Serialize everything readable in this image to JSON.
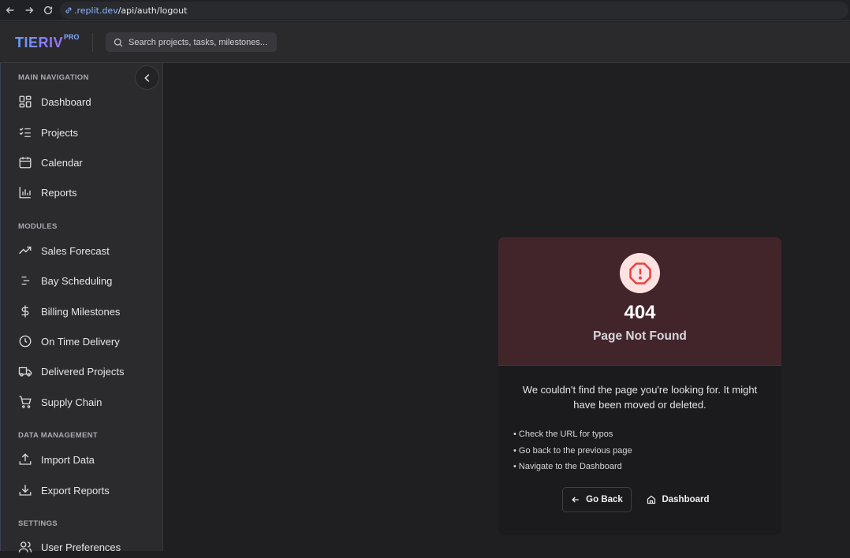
{
  "browser": {
    "url_host": ".replit.dev",
    "url_path": "/api/auth/logout"
  },
  "header": {
    "brand": "TIERIV",
    "brand_badge": "PRO",
    "search_placeholder": "Search projects, tasks, milestones..."
  },
  "sidebar": {
    "sections": {
      "main": "MAIN NAVIGATION",
      "modules": "MODULES",
      "data": "DATA MANAGEMENT",
      "settings": "SETTINGS"
    },
    "main_items": [
      {
        "label": "Dashboard",
        "icon": "dashboard-grid-icon"
      },
      {
        "label": "Projects",
        "icon": "checklist-icon"
      },
      {
        "label": "Calendar",
        "icon": "calendar-icon"
      },
      {
        "label": "Reports",
        "icon": "bar-chart-icon"
      }
    ],
    "module_items": [
      {
        "label": "Sales Forecast",
        "icon": "trend-up-icon"
      },
      {
        "label": "Bay Scheduling",
        "icon": "schedule-lines-icon"
      },
      {
        "label": "Billing Milestones",
        "icon": "dollar-icon"
      },
      {
        "label": "On Time Delivery",
        "icon": "clock-icon"
      },
      {
        "label": "Delivered Projects",
        "icon": "truck-icon"
      },
      {
        "label": "Supply Chain",
        "icon": "cart-icon"
      }
    ],
    "data_items": [
      {
        "label": "Import Data",
        "icon": "upload-icon"
      },
      {
        "label": "Export Reports",
        "icon": "download-icon"
      }
    ],
    "settings_items": [
      {
        "label": "User Preferences",
        "icon": "users-icon"
      }
    ]
  },
  "error": {
    "code": "404",
    "title": "Page Not Found",
    "message": "We couldn't find the page you're looking for. It might have been moved or deleted.",
    "tips": [
      "• Check the URL for typos",
      "• Go back to the previous page",
      "• Navigate to the Dashboard"
    ],
    "back_label": "Go Back",
    "home_label": "Dashboard"
  }
}
